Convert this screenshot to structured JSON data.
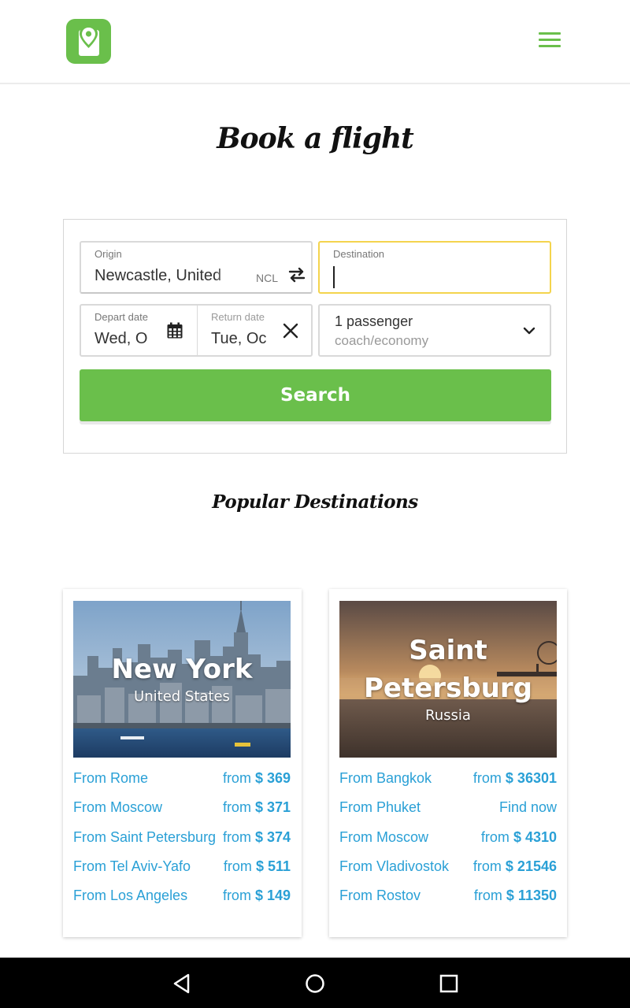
{
  "header": {
    "logo": "location-pin-tag-logo",
    "menu_icon": "hamburger-menu-icon"
  },
  "title": "Book a flight",
  "form": {
    "origin_label": "Origin",
    "origin_value": "Newcastle, United",
    "origin_code": "NCL",
    "destination_label": "Destination",
    "destination_value": "",
    "depart_label": "Depart date",
    "depart_value": "Wed, O",
    "return_label": "Return date",
    "return_value": "Tue, Oc",
    "passengers": "1 passenger",
    "cabin": "coach/economy",
    "search_label": "Search"
  },
  "popular_title": "Popular Destinations",
  "destinations": [
    {
      "city": "New York",
      "country": "United States",
      "routes": [
        {
          "from": "From Rome",
          "price_prefix": "from",
          "price": "$ 369"
        },
        {
          "from": "From Moscow",
          "price_prefix": "from",
          "price": "$ 371"
        },
        {
          "from": "From Saint Petersburg",
          "price_prefix": "from",
          "price": "$ 374"
        },
        {
          "from": "From Tel Aviv-Yafo",
          "price_prefix": "from",
          "price": "$ 511"
        },
        {
          "from": "From Los Angeles",
          "price_prefix": "from",
          "price": "$ 149"
        }
      ]
    },
    {
      "city": "Saint Petersburg",
      "country": "Russia",
      "routes": [
        {
          "from": "From Bangkok",
          "price_prefix": "from",
          "price": "$ 36301"
        },
        {
          "from": "From Phuket",
          "price_prefix": "",
          "price": "Find now"
        },
        {
          "from": "From Moscow",
          "price_prefix": "from",
          "price": "$ 4310"
        },
        {
          "from": "From Vladivostok",
          "price_prefix": "from",
          "price": "$ 21546"
        },
        {
          "from": "From Rostov",
          "price_prefix": "from",
          "price": "$ 11350"
        }
      ]
    }
  ],
  "colors": {
    "brand_green": "#6abf4b",
    "link_blue": "#2aa0d6",
    "focus_yellow": "#f4d44d"
  }
}
